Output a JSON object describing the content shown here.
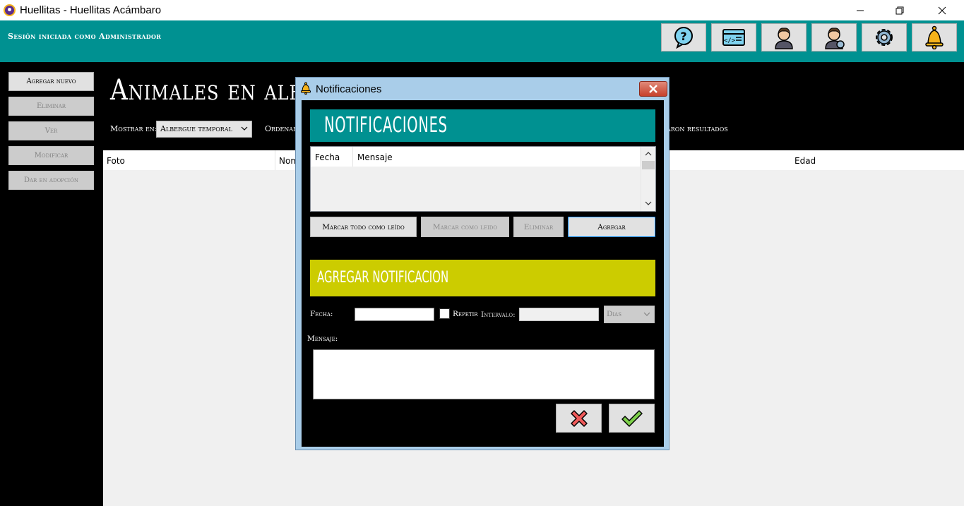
{
  "window": {
    "title": "Huellitas - Huellitas Acámbaro"
  },
  "header": {
    "session_text": "Sesión iniciada como Administrador",
    "toolbar_icons": [
      "help-icon",
      "code-window-icon",
      "user-icon",
      "user-settings-icon",
      "settings-gear-icon",
      "bell-icon"
    ]
  },
  "sidebar": {
    "items": [
      {
        "label": "Agregar nuevo",
        "enabled": true
      },
      {
        "label": "Eliminar",
        "enabled": false
      },
      {
        "label": "Ver",
        "enabled": false
      },
      {
        "label": "Modificar",
        "enabled": false
      },
      {
        "label": "Dar en adopción",
        "enabled": false
      }
    ]
  },
  "main": {
    "heading": "Animales en alberg",
    "show_label": "Mostrar en:",
    "show_value": "Albergue temporal",
    "order_label": "Ordenar",
    "results_text": "aron resultados",
    "columns": [
      "Foto",
      "Nom",
      "Edad"
    ]
  },
  "dialog": {
    "title": "Notificaciones",
    "header": "NOTIFICACIONES",
    "list_columns": [
      "Fecha",
      "Mensaje"
    ],
    "buttons": {
      "mark_all": "Marcar todo como leído",
      "mark_read": "Marcar como leido",
      "delete": "Eliminar",
      "add": "Agregar"
    },
    "add_header": "AGREGAR NOTIFICACION",
    "date_label": "Fecha:",
    "date_value": "",
    "repeat_label": "Repetir",
    "interval_label": "Intervalo:",
    "interval_value": "",
    "unit_value": "Dias",
    "message_label": "Mensaje:",
    "message_value": ""
  },
  "colors": {
    "teal": "#009191",
    "olive": "#cccc00",
    "background": "#000000"
  }
}
